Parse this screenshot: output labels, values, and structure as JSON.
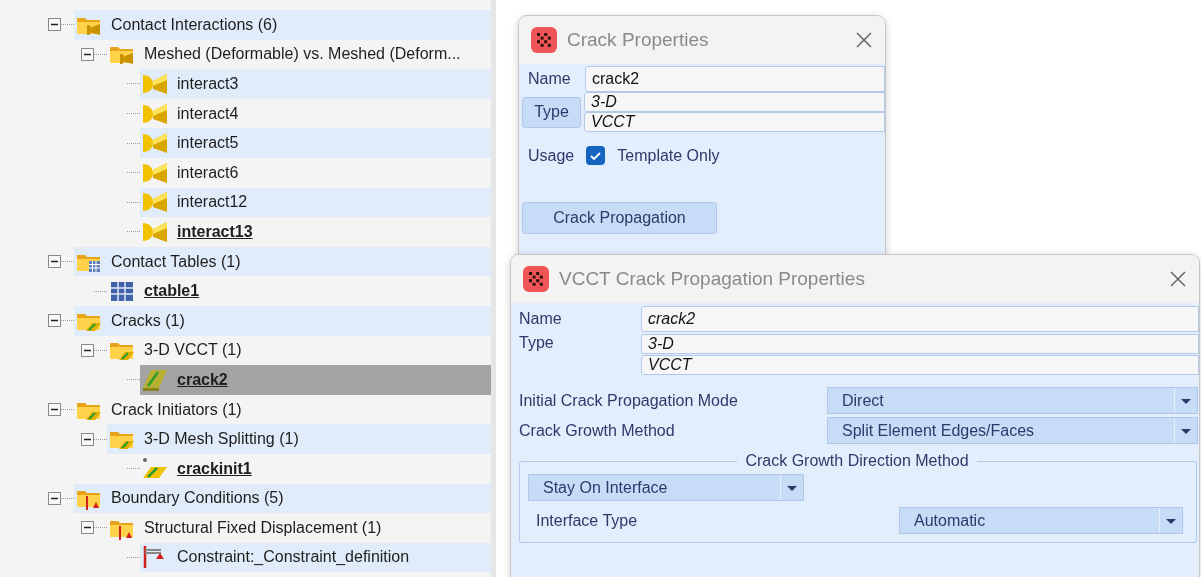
{
  "tree": [
    {
      "label": "Contact Interactions (6)",
      "kind": "interaction-group",
      "expanded": true,
      "bold": false,
      "selected": false,
      "children": [
        {
          "label": "Meshed (Deformable) vs. Meshed (Deform...",
          "kind": "interaction-group",
          "expanded": true,
          "bold": false,
          "selected": false,
          "children": [
            {
              "label": "interact3",
              "kind": "interaction",
              "bold": false,
              "selected": false
            },
            {
              "label": "interact4",
              "kind": "interaction",
              "bold": false,
              "selected": false
            },
            {
              "label": "interact5",
              "kind": "interaction",
              "bold": false,
              "selected": false
            },
            {
              "label": "interact6",
              "kind": "interaction",
              "bold": false,
              "selected": false
            },
            {
              "label": "interact12",
              "kind": "interaction",
              "bold": false,
              "selected": false
            },
            {
              "label": "interact13",
              "kind": "interaction",
              "bold": true,
              "selected": false
            }
          ]
        }
      ]
    },
    {
      "label": "Contact Tables (1)",
      "kind": "table-group",
      "expanded": true,
      "bold": false,
      "selected": false,
      "children": [
        {
          "label": "ctable1",
          "kind": "table",
          "bold": true,
          "selected": false
        }
      ]
    },
    {
      "label": "Cracks (1)",
      "kind": "crack-group",
      "expanded": true,
      "bold": false,
      "selected": false,
      "children": [
        {
          "label": "3-D VCCT (1)",
          "kind": "crack-group",
          "expanded": true,
          "bold": false,
          "selected": false,
          "children": [
            {
              "label": "crack2",
              "kind": "crack",
              "bold": true,
              "selected": true
            }
          ]
        }
      ]
    },
    {
      "label": "Crack Initiators (1)",
      "kind": "crack-group",
      "expanded": true,
      "bold": false,
      "selected": false,
      "children": [
        {
          "label": "3-D Mesh Splitting (1)",
          "kind": "crack-group",
          "expanded": true,
          "bold": false,
          "selected": false,
          "children": [
            {
              "label": "crackinit1",
              "kind": "initiator",
              "bold": true,
              "selected": false
            }
          ]
        }
      ]
    },
    {
      "label": "Boundary Conditions (5)",
      "kind": "constraint-group",
      "expanded": true,
      "bold": false,
      "selected": false,
      "children": [
        {
          "label": "Structural Fixed Displacement (1)",
          "kind": "constraint-group",
          "expanded": true,
          "bold": false,
          "selected": false,
          "children": [
            {
              "label": "Constraint:_Constraint_definition",
              "kind": "constraint",
              "bold": false,
              "selected": false
            }
          ]
        }
      ]
    }
  ],
  "crack_properties": {
    "title": "Crack Properties",
    "name_label": "Name",
    "name_value": "crack2",
    "type_button": "Type",
    "type_values": [
      "3-D",
      "VCCT"
    ],
    "usage_label": "Usage",
    "template_only": {
      "label": "Template Only",
      "checked": true
    },
    "propagation_button": "Crack Propagation"
  },
  "vcct_dialog": {
    "title": "VCCT Crack Propagation Properties",
    "name_label": "Name",
    "name_value": "crack2",
    "type_label": "Type",
    "type_values": [
      "3-D",
      "VCCT"
    ],
    "dropdowns": [
      {
        "label": "Initial Crack Propagation Mode",
        "value": "Direct"
      },
      {
        "label": "Crack Growth Method",
        "value": "Split Element Edges/Faces"
      }
    ],
    "direction_group": {
      "title": "Crack Growth Direction Method",
      "method": "Stay On Interface",
      "interface_label": "Interface Type",
      "interface_value": "Automatic"
    }
  }
}
